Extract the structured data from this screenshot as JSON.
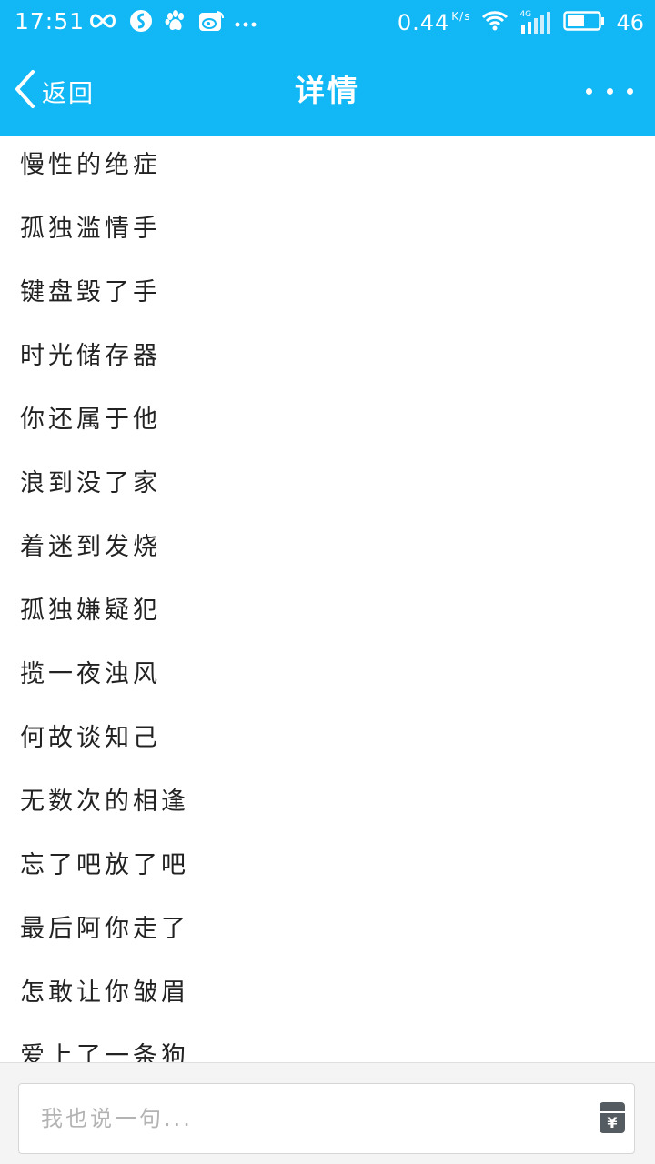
{
  "status_bar": {
    "time": "17:51",
    "net_speed": "0.44",
    "net_speed_unit": "K/s",
    "network_type": "4G",
    "battery_level": "46",
    "icons": [
      "infinity-icon",
      "app-s-icon",
      "baidu-paw-icon",
      "weibo-icon",
      "more-notifications-icon",
      "wifi-icon",
      "signal-icon",
      "battery-icon"
    ]
  },
  "header": {
    "back_label": "返回",
    "title": "详情",
    "background": "#12b7f5"
  },
  "content": {
    "lines": [
      "慢性的绝症",
      "孤独滥情手",
      "键盘毁了手",
      "时光储存器",
      "你还属于他",
      "浪到没了家",
      "着迷到发烧",
      "孤独嫌疑犯",
      "揽一夜浊风",
      "何故谈知己",
      "无数次的相逢",
      "忘了吧放了吧",
      "最后阿你走了",
      "怎敢让你皱眉",
      "爱上了一条狗"
    ]
  },
  "comment_bar": {
    "placeholder": "我也说一句...",
    "redpacket_symbol": "¥"
  }
}
